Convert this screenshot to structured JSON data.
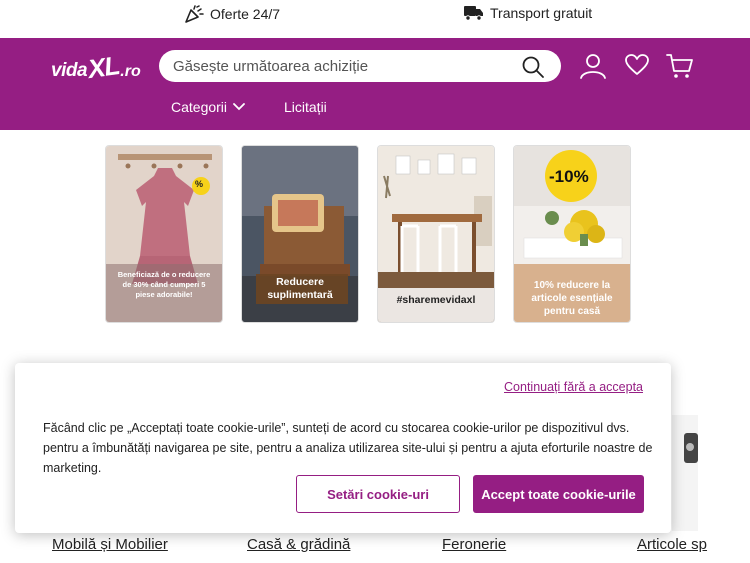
{
  "topbar": {
    "offers_label": "Oferte 24/7",
    "shipping_label": "Transport gratuit"
  },
  "header": {
    "logo_part1": "vida",
    "logo_part2": "XL",
    "logo_part3": ".ro",
    "search_placeholder": "Găsește următoarea achiziție",
    "nav": {
      "categories_label": "Categorii",
      "auctions_label": "Licitații"
    }
  },
  "promos": [
    {
      "label": "Beneficiază de o reducere de 30% când cumperi 5 piese adorabile!",
      "badge": "%"
    },
    {
      "label": "Reducere suplimentară"
    },
    {
      "label": "#sharemevidaxl"
    },
    {
      "label": "10% reducere la articole esențiale pentru casă",
      "badge": "-10%"
    }
  ],
  "categories": [
    {
      "label": "Mobilă și Mobilier"
    },
    {
      "label": "Casă & grădină"
    },
    {
      "label": "Feronerie"
    },
    {
      "label": "Articole sp"
    }
  ],
  "cookie": {
    "continue_label": "Continuați fără a accepta",
    "message": "Făcând clic pe „Acceptați toate cookie-urile”, sunteți de acord cu stocarea cookie-urilor pe dispozitivul dvs. pentru a îmbunătăți navigarea pe site, pentru a analiza utilizarea site-ului și pentru a ajuta eforturile noastre de marketing.",
    "settings_label": "Setări cookie-uri",
    "accept_label": "Accept toate cookie-urile"
  },
  "colors": {
    "brand": "#951e83",
    "badge_yellow": "#f7d21a"
  }
}
